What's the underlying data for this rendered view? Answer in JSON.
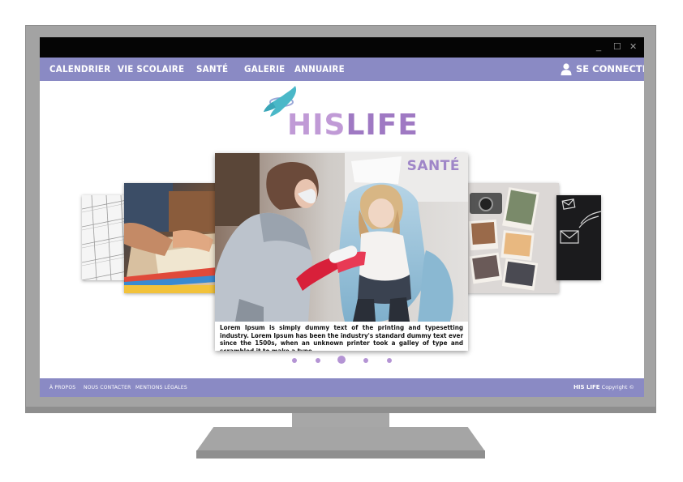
{
  "window": {
    "controls": {
      "minimize": "_",
      "maximize": "☐",
      "close": "✕"
    }
  },
  "nav": {
    "items": [
      "CALENDRIER",
      "VIE SCOLAIRE",
      "SANTÉ",
      "GALERIE",
      "ANNUAIRE"
    ],
    "login_label": "SE CONNECTER"
  },
  "logo": {
    "his": "HIS",
    "life": "LIFE"
  },
  "carousel": {
    "active_title": "SANTÉ",
    "active_text": "Lorem Ipsum is simply dummy text of the printing and typesetting industry. Lorem Ipsum has been the industry's standard dummy text ever since the 1500s, when an unknown printer took a galley of type and scrambled it to make a type...",
    "slide_count": 5,
    "active_index": 2
  },
  "footer": {
    "links": [
      "À PROPOS",
      "NOUS CONTACTER",
      "MENTIONS LÉGALES"
    ],
    "brand": "HIS LIFE",
    "copyright": "Copyright ©"
  },
  "colors": {
    "nav_bg": "#8a8ac4",
    "accent_purple": "#9f79c3",
    "logo_light_purple": "#c09ad6",
    "logo_wing_teal": "#4ab8c8",
    "dots": "#b494d4",
    "monitor_grey": "#a3a3a3"
  }
}
